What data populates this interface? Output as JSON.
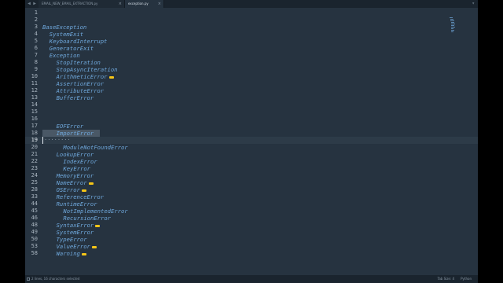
{
  "tabs": [
    {
      "label": "EMAIL_NEW_EMAIL_EXTRACTION.py",
      "active": false
    },
    {
      "label": "exception.py",
      "active": true
    }
  ],
  "gutter": [
    "1",
    "2",
    "3",
    "4",
    "5",
    "6",
    "7",
    "8",
    "9",
    "10",
    "11",
    "12",
    "13",
    "14",
    "15",
    "16",
    "17",
    "18",
    "19",
    "20",
    "21",
    "22",
    "23",
    "24",
    "25",
    "28",
    "33",
    "44",
    "45",
    "46",
    "48",
    "49",
    "50",
    "53",
    "58"
  ],
  "code": [
    {
      "text": "",
      "indent": 0,
      "folded": false
    },
    {
      "text": "",
      "indent": 0,
      "folded": false
    },
    {
      "text": "BaseException",
      "indent": 0,
      "folded": false
    },
    {
      "text": "SystemExit",
      "indent": 1,
      "folded": false
    },
    {
      "text": "KeyboardInterrupt",
      "indent": 1,
      "folded": false
    },
    {
      "text": "GeneratorExit",
      "indent": 1,
      "folded": false
    },
    {
      "text": "Exception",
      "indent": 1,
      "folded": false
    },
    {
      "text": "StopIteration",
      "indent": 2,
      "folded": false
    },
    {
      "text": "StopAsyncIteration",
      "indent": 2,
      "folded": false
    },
    {
      "text": "ArithmeticError",
      "indent": 2,
      "folded": true
    },
    {
      "text": "AssertionError",
      "indent": 2,
      "folded": false
    },
    {
      "text": "AttributeError",
      "indent": 2,
      "folded": false
    },
    {
      "text": "BufferError",
      "indent": 2,
      "folded": false
    },
    {
      "text": "EOFError",
      "indent": 2,
      "folded": false
    },
    {
      "text": "ImportError",
      "indent": 2,
      "folded": false
    },
    {
      "text": "",
      "indent": 0,
      "folded": false
    },
    {
      "text": "ModuleNotFoundError",
      "indent": 3,
      "folded": false
    },
    {
      "text": "LookupError",
      "indent": 2,
      "folded": false
    },
    {
      "text": "IndexError",
      "indent": 3,
      "folded": false
    },
    {
      "text": "KeyError",
      "indent": 3,
      "folded": false
    },
    {
      "text": "MemoryError",
      "indent": 2,
      "folded": false
    },
    {
      "text": "NameError",
      "indent": 2,
      "folded": true
    },
    {
      "text": "OSError",
      "indent": 2,
      "folded": true
    },
    {
      "text": "ReferenceError",
      "indent": 2,
      "folded": false
    },
    {
      "text": "RuntimeError",
      "indent": 2,
      "folded": false
    },
    {
      "text": "NotImplementedError",
      "indent": 3,
      "folded": false
    },
    {
      "text": "RecursionError",
      "indent": 3,
      "folded": false
    },
    {
      "text": "SyntaxError",
      "indent": 2,
      "folded": true
    },
    {
      "text": "SystemError",
      "indent": 2,
      "folded": false
    },
    {
      "text": "TypeError",
      "indent": 2,
      "folded": false
    },
    {
      "text": "ValueError",
      "indent": 2,
      "folded": true
    },
    {
      "text": "Warning",
      "indent": 2,
      "folded": true
    }
  ],
  "status": {
    "left": "2 lines, 16 characters selected",
    "tab_size": "Tab Size: 4",
    "syntax": "Python"
  },
  "colors": {
    "background": "#263340",
    "code": "#6fa8dc",
    "fold_marker": "#f5c518",
    "selection": "#4a5866"
  }
}
